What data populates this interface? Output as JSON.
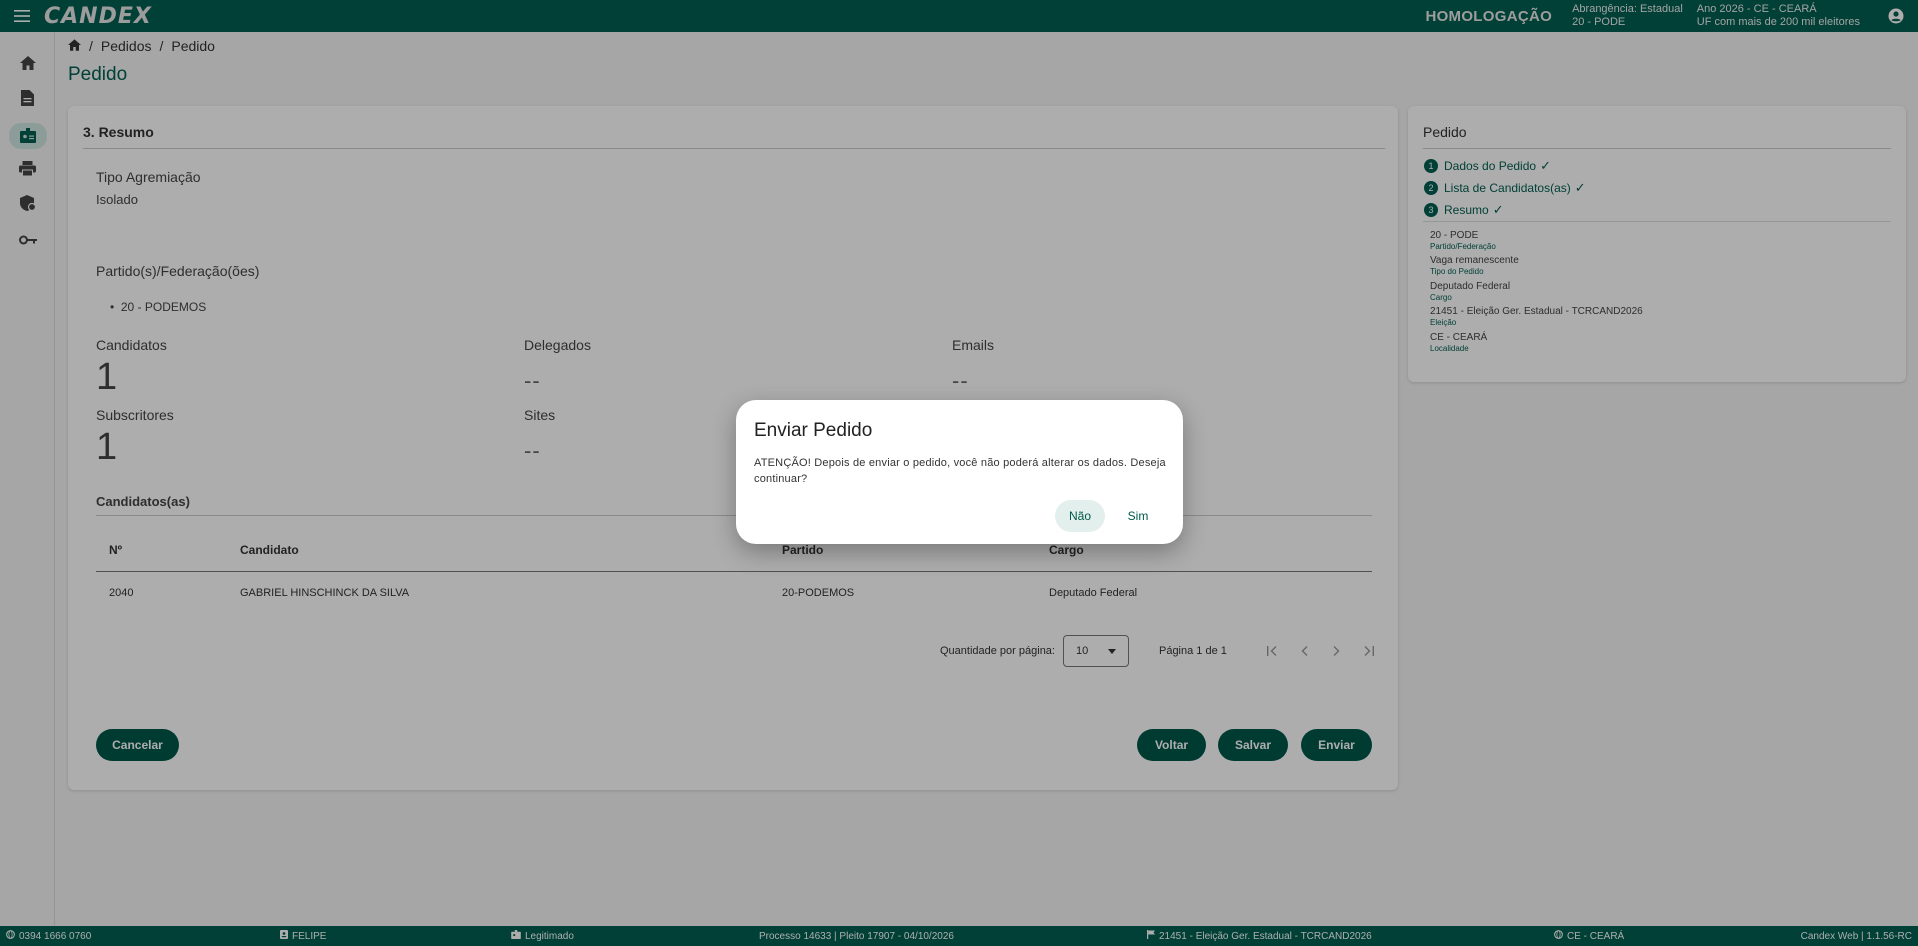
{
  "app": {
    "logo": "CANDEX",
    "environment": "HOMOLOGAÇÃO",
    "scope_line1": "Abrangência: Estadual",
    "scope_line2": "20 - PODE",
    "year_line1": "Ano 2026 - CE - CEARÁ",
    "year_line2": "UF com mais de 200 mil eleitores"
  },
  "sidebar": {
    "items": [
      {
        "icon": "home-icon"
      },
      {
        "icon": "document-icon"
      },
      {
        "icon": "badge-icon"
      },
      {
        "icon": "print-icon"
      },
      {
        "icon": "security-icon"
      },
      {
        "icon": "key-icon"
      }
    ]
  },
  "breadcrumb": {
    "items": [
      "Pedidos",
      "Pedido"
    ],
    "sep": "/"
  },
  "page": {
    "title": "Pedido"
  },
  "summary": {
    "section_title": "3. Resumo",
    "agremiacao_label": "Tipo Agremiação",
    "agremiacao_value": "Isolado",
    "partidos_label": "Partido(s)/Federação(ões)",
    "partidos_items": [
      "20 - PODEMOS"
    ],
    "candidatos_label": "Candidatos",
    "candidatos_value": "1",
    "delegados_label": "Delegados",
    "delegados_value": "--",
    "emails_label": "Emails",
    "emails_value": "--",
    "subscritores_label": "Subscritores",
    "subscritores_value": "1",
    "sites_label": "Sites",
    "sites_value": "--",
    "candidatos_section": "Candidatos(as)"
  },
  "table": {
    "headers": [
      "Nº",
      "Candidato",
      "Partido",
      "Cargo"
    ],
    "rows": [
      [
        "2040",
        "GABRIEL HINSCHINCK DA SILVA",
        "20-PODEMOS",
        "Deputado Federal"
      ]
    ]
  },
  "paginator": {
    "per_page_label": "Quantidade por página:",
    "per_page_value": "10",
    "page_label": "Página 1 de 1"
  },
  "actions": {
    "cancel": "Cancelar",
    "back": "Voltar",
    "save": "Salvar",
    "send": "Enviar"
  },
  "side": {
    "title": "Pedido",
    "steps": [
      {
        "num": "1",
        "label": "Dados do Pedido"
      },
      {
        "num": "2",
        "label": "Lista de Candidatos(as)"
      },
      {
        "num": "3",
        "label": "Resumo"
      }
    ],
    "details": [
      {
        "value": "20 - PODE",
        "label": "Partido/Federação"
      },
      {
        "value": "Vaga remanescente",
        "label": "Tipo do Pedido"
      },
      {
        "value": "Deputado Federal",
        "label": "Cargo"
      },
      {
        "value": "21451 - Eleição Ger. Estadual - TCRCAND2026",
        "label": "Eleição"
      },
      {
        "value": "CE - CEARÁ",
        "label": "Localidade"
      }
    ]
  },
  "footer": {
    "ip": "0394 1666 0760",
    "user": "FELIPE",
    "status": "Legitimado",
    "process": "Processo 14633 | Pleito 17907 - 04/10/2026",
    "election": "21451 - Eleição Ger. Estadual - TCRCAND2026",
    "locality": "CE - CEARÁ",
    "version": "Candex Web | 1.1.56-RC"
  },
  "dialog": {
    "title": "Enviar Pedido",
    "message": "ATENÇÃO! Depois de enviar o pedido, você não poderá alterar os dados. Deseja continuar?",
    "no": "Não",
    "yes": "Sim"
  },
  "colors": {
    "primary": "#005f50",
    "overlay": "rgba(0,0,0,0.32)"
  }
}
